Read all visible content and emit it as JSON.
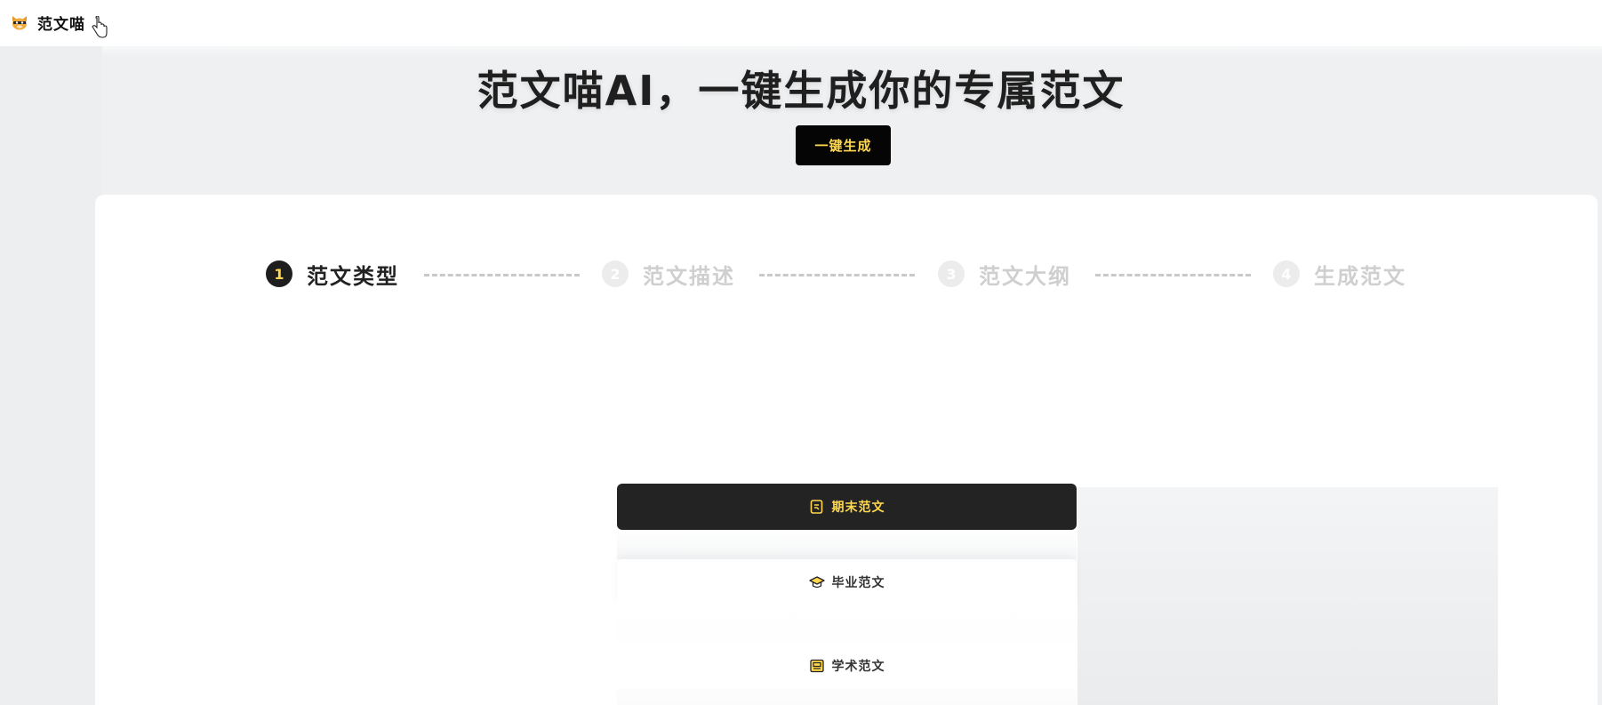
{
  "app": {
    "brand_name": "范文喵"
  },
  "hero": {
    "title": "范文喵AI，一键生成你的专属范文",
    "generate_button": "一键生成"
  },
  "stepper": {
    "steps": [
      {
        "number": "1",
        "label": "范文类型",
        "state": "active"
      },
      {
        "number": "2",
        "label": "范文描述",
        "state": "inactive"
      },
      {
        "number": "3",
        "label": "范文大纲",
        "state": "inactive"
      },
      {
        "number": "4",
        "label": "生成范文",
        "state": "inactive"
      }
    ]
  },
  "essay_types": [
    {
      "label": "期末范文",
      "icon": "exam-note-icon",
      "selected": true
    },
    {
      "label": "毕业范文",
      "icon": "graduation-cap-icon",
      "selected": false
    },
    {
      "label": "学术范文",
      "icon": "academic-book-icon",
      "selected": false
    }
  ],
  "colors": {
    "accent_yellow": "#ffd84d",
    "dark": "#232323",
    "background": "#eef0f2"
  }
}
